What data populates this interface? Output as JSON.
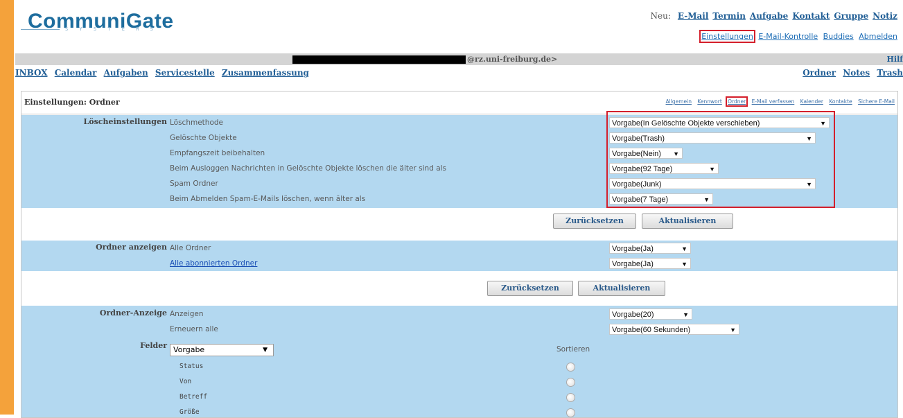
{
  "logo": {
    "name": "CommuniGate",
    "sub": "S Y S T E M S"
  },
  "header": {
    "new_label": "Neu:",
    "new_links": [
      "E-Mail",
      "Termin",
      "Aufgabe",
      "Kontakt",
      "Gruppe",
      "Notiz"
    ],
    "user_links": [
      "Einstellungen",
      "E-Mail-Kontrolle",
      "Buddies",
      "Abmelden"
    ],
    "email_domain": "@rz.uni-freiburg.de>",
    "help": "Hilf"
  },
  "nav": {
    "left": [
      "INBOX",
      "Calendar",
      "Aufgaben",
      "Servicestelle",
      "Zusammenfassung"
    ],
    "right": [
      "Ordner",
      "Notes",
      "Trash"
    ]
  },
  "box": {
    "title": "Einstellungen: Ordner",
    "subtabs": [
      "Allgemein",
      "Kennwort",
      "Ordner",
      "E-Mail verfassen",
      "Kalender",
      "Kontakte",
      "Sichere E-Mail"
    ]
  },
  "loesch": {
    "section": "Löscheinstellungen",
    "rows": [
      {
        "label": "Löschmethode",
        "value": "Vorgabe(In Gelöschte Objekte verschieben)"
      },
      {
        "label": "Gelöschte Objekte",
        "value": "Vorgabe(Trash)"
      },
      {
        "label": "Empfangszeit beibehalten",
        "value": "Vorgabe(Nein)"
      },
      {
        "label": "Beim Ausloggen Nachrichten in Gelöschte Objekte löschen die älter sind als",
        "value": "Vorgabe(92 Tage)"
      },
      {
        "label": "Spam Ordner",
        "value": "Vorgabe(Junk)"
      },
      {
        "label": "Beim Abmelden Spam-E-Mails löschen, wenn älter als",
        "value": "Vorgabe(7 Tage)"
      }
    ]
  },
  "buttons": {
    "reset": "Zurücksetzen",
    "update": "Aktualisieren"
  },
  "anzeigen": {
    "section": "Ordner anzeigen",
    "rows": [
      {
        "label": "Alle Ordner",
        "value": "Vorgabe(Ja)"
      },
      {
        "label": "Alle abonnierten Ordner",
        "value": "Vorgabe(Ja)"
      }
    ]
  },
  "anzeige": {
    "section": "Ordner-Anzeige",
    "rows": [
      {
        "label": "Anzeigen",
        "value": "Vorgabe(20)"
      },
      {
        "label": "Erneuern alle",
        "value": "Vorgabe(60 Sekunden)"
      }
    ]
  },
  "felder": {
    "section": "Felder",
    "select": "Vorgabe",
    "sort_header": "Sortieren",
    "fields": [
      "Status",
      "Von",
      "Betreff",
      "Größe"
    ]
  },
  "icons": {
    "dropdown": "chevron-down-icon",
    "radio": "radio-icon"
  },
  "colors": {
    "accent": "#f4a23b",
    "row": "#b3d8f0",
    "highlight": "#d41f2b",
    "link": "#225f96"
  }
}
